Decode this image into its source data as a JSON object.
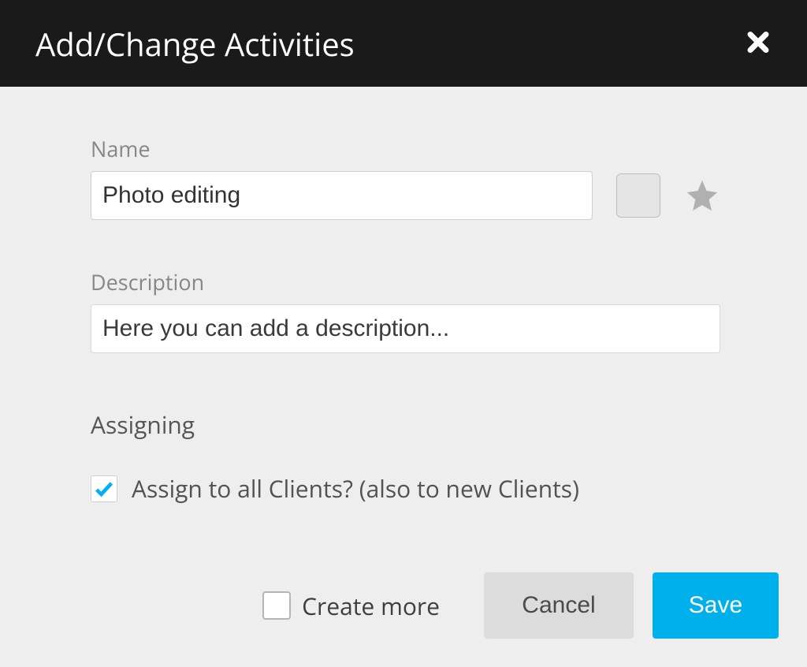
{
  "header": {
    "title": "Add/Change Activities"
  },
  "fields": {
    "name_label": "Name",
    "name_value": "Photo editing",
    "description_label": "Description",
    "description_placeholder": "Here you can add a description..."
  },
  "assigning": {
    "section_title": "Assigning",
    "assign_all_label": "Assign to all Clients? (also to new Clients)",
    "assign_all_checked": true
  },
  "footer": {
    "create_more_label": "Create more",
    "create_more_checked": false,
    "cancel_label": "Cancel",
    "save_label": "Save"
  },
  "colors": {
    "primary": "#00b0ea",
    "check": "#00b0f0"
  }
}
